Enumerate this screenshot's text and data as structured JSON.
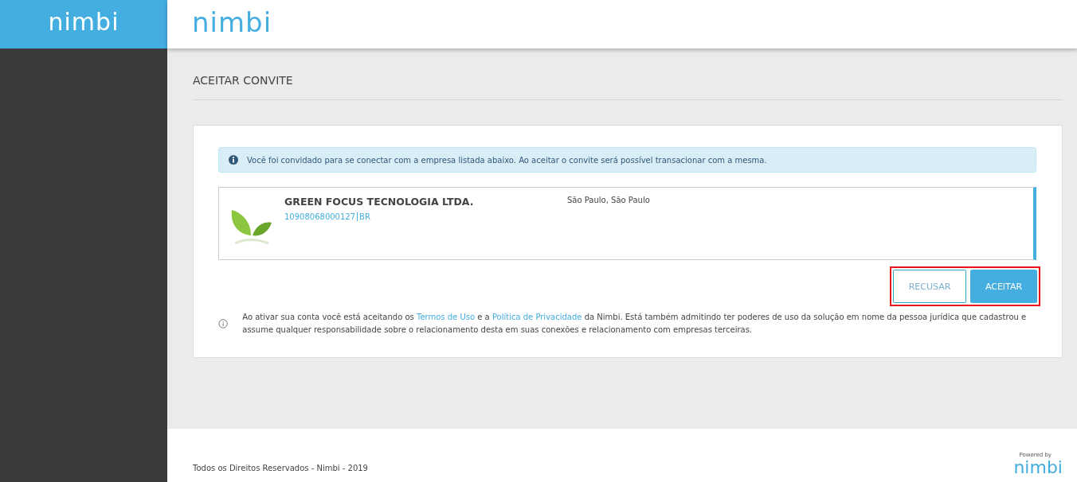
{
  "sidebar": {
    "logo": "nimbi"
  },
  "header": {
    "logo": "nimbi"
  },
  "page": {
    "title": "ACEITAR CONVITE"
  },
  "alert": {
    "text": "Você foi convidado para se conectar com a empresa listada abaixo. Ao aceitar o convite será possível transacionar com a mesma."
  },
  "company": {
    "name": "GREEN FOCUS TECNOLOGIA LTDA.",
    "document": "10908068000127",
    "country": "BR",
    "location": "São Paulo, São Paulo"
  },
  "buttons": [
    {
      "label": "RECUSAR",
      "kind": "secondary"
    },
    {
      "label": "ACEITAR",
      "kind": "primary"
    }
  ],
  "notice": {
    "parts": [
      {
        "kind": "text",
        "text": "Ao ativar sua conta você está aceitando os "
      },
      {
        "kind": "link",
        "text": "Termos de Uso"
      },
      {
        "kind": "text",
        "text": " e a "
      },
      {
        "kind": "link",
        "text": "Política de Privacidade"
      },
      {
        "kind": "text",
        "text": " da Nimbi. Está também admitindo ter poderes de uso da solução em nome da pessoa jurídica que cadastrou e assume qualquer responsabilidade sobre o relacionamento desta em suas conexões e relacionamento com empresas terceiras."
      }
    ]
  },
  "footer": {
    "text": "Todos os Direitos Reservados - Nimbi - 2019",
    "powered_by": "Powered by",
    "logo": "nimbi"
  }
}
